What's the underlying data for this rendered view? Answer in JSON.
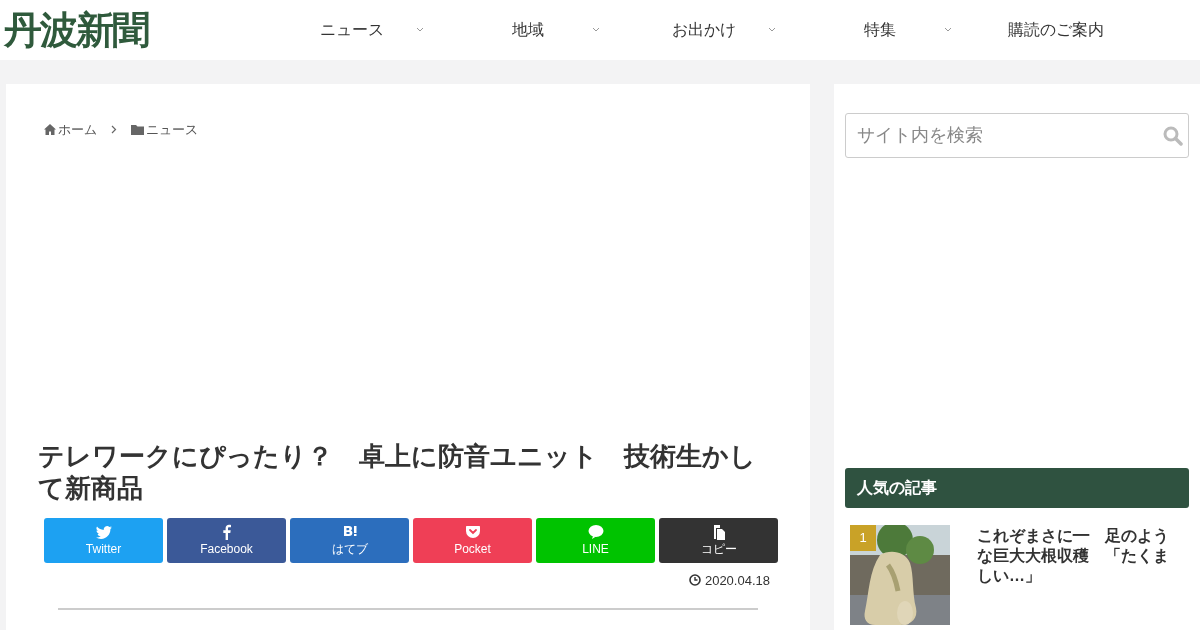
{
  "header": {
    "logo": "丹波新聞",
    "nav": [
      {
        "label": "ニュース",
        "has_submenu": true
      },
      {
        "label": "地域",
        "has_submenu": true
      },
      {
        "label": "お出かけ",
        "has_submenu": true
      },
      {
        "label": "特集",
        "has_submenu": true
      },
      {
        "label": "購読のご案内",
        "has_submenu": false
      }
    ]
  },
  "breadcrumb": [
    {
      "kind": "home",
      "label": "ホーム"
    },
    {
      "kind": "folder",
      "label": "ニュース"
    }
  ],
  "article": {
    "title": "テレワークにぴったり？　卓上に防音ユニット　技術生かして新商品",
    "share_buttons": [
      {
        "kind": "twitter",
        "label": "Twitter",
        "color": "#1da1f2"
      },
      {
        "kind": "facebook",
        "label": "Facebook",
        "color": "#3b5998"
      },
      {
        "kind": "hatena",
        "label": "はてブ",
        "color": "#2c6ebd"
      },
      {
        "kind": "pocket",
        "label": "Pocket",
        "color": "#ef3f56"
      },
      {
        "kind": "line",
        "label": "LINE",
        "color": "#00c300"
      },
      {
        "kind": "copy",
        "label": "コピー",
        "color": "#333333"
      }
    ],
    "date": "2020.04.18"
  },
  "sidebar": {
    "search": {
      "placeholder": "サイト内を検索"
    },
    "popular": {
      "heading": "人気の記事",
      "items": [
        {
          "rank": "1",
          "title": "これぞまさに━　足のような巨大大根収穫　「たくましい…」"
        }
      ]
    }
  }
}
